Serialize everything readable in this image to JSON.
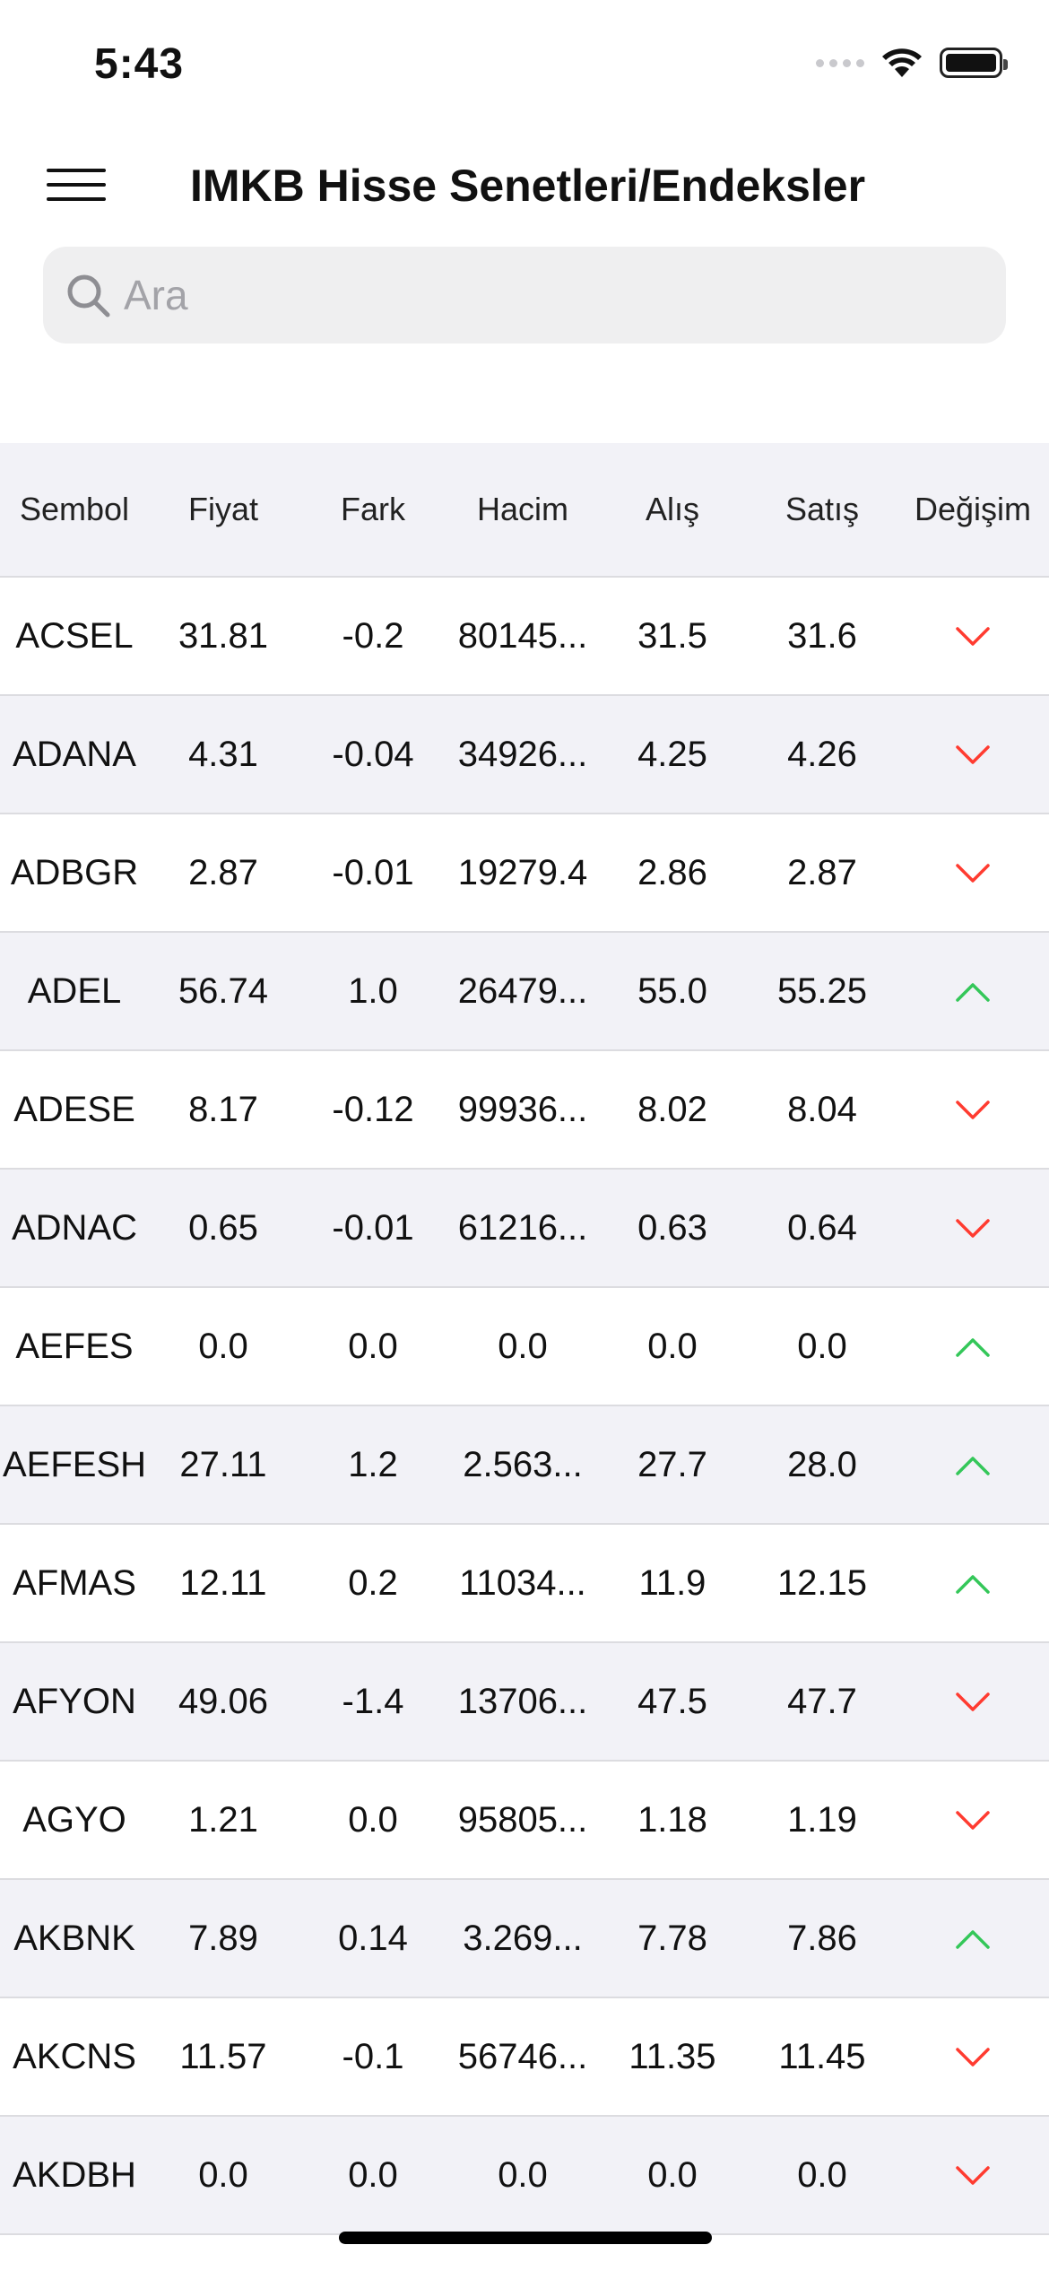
{
  "status": {
    "time": "5:43"
  },
  "nav": {
    "title": "IMKB Hisse Senetleri/Endeksler"
  },
  "search": {
    "placeholder": "Ara",
    "value": ""
  },
  "colors": {
    "down": "#ff3b30",
    "up": "#34c759"
  },
  "table": {
    "headers": [
      "Sembol",
      "Fiyat",
      "Fark",
      "Hacim",
      "Alış",
      "Satış",
      "Değişim"
    ],
    "rows": [
      {
        "sembol": "ACSEL",
        "fiyat": "31.81",
        "fark": "-0.2",
        "hacim": "80145...",
        "alis": "31.5",
        "satis": "31.6",
        "trend": "down"
      },
      {
        "sembol": "ADANA",
        "fiyat": "4.31",
        "fark": "-0.04",
        "hacim": "34926...",
        "alis": "4.25",
        "satis": "4.26",
        "trend": "down"
      },
      {
        "sembol": "ADBGR",
        "fiyat": "2.87",
        "fark": "-0.01",
        "hacim": "19279.4",
        "alis": "2.86",
        "satis": "2.87",
        "trend": "down"
      },
      {
        "sembol": "ADEL",
        "fiyat": "56.74",
        "fark": "1.0",
        "hacim": "26479...",
        "alis": "55.0",
        "satis": "55.25",
        "trend": "up"
      },
      {
        "sembol": "ADESE",
        "fiyat": "8.17",
        "fark": "-0.12",
        "hacim": "99936...",
        "alis": "8.02",
        "satis": "8.04",
        "trend": "down"
      },
      {
        "sembol": "ADNAC",
        "fiyat": "0.65",
        "fark": "-0.01",
        "hacim": "61216...",
        "alis": "0.63",
        "satis": "0.64",
        "trend": "down"
      },
      {
        "sembol": "AEFES",
        "fiyat": "0.0",
        "fark": "0.0",
        "hacim": "0.0",
        "alis": "0.0",
        "satis": "0.0",
        "trend": "up"
      },
      {
        "sembol": "AEFESH",
        "fiyat": "27.11",
        "fark": "1.2",
        "hacim": "2.563...",
        "alis": "27.7",
        "satis": "28.0",
        "trend": "up"
      },
      {
        "sembol": "AFMAS",
        "fiyat": "12.11",
        "fark": "0.2",
        "hacim": "11034...",
        "alis": "11.9",
        "satis": "12.15",
        "trend": "up"
      },
      {
        "sembol": "AFYON",
        "fiyat": "49.06",
        "fark": "-1.4",
        "hacim": "13706...",
        "alis": "47.5",
        "satis": "47.7",
        "trend": "down"
      },
      {
        "sembol": "AGYO",
        "fiyat": "1.21",
        "fark": "0.0",
        "hacim": "95805...",
        "alis": "1.18",
        "satis": "1.19",
        "trend": "down"
      },
      {
        "sembol": "AKBNK",
        "fiyat": "7.89",
        "fark": "0.14",
        "hacim": "3.269...",
        "alis": "7.78",
        "satis": "7.86",
        "trend": "up"
      },
      {
        "sembol": "AKCNS",
        "fiyat": "11.57",
        "fark": "-0.1",
        "hacim": "56746...",
        "alis": "11.35",
        "satis": "11.45",
        "trend": "down"
      },
      {
        "sembol": "AKDBH",
        "fiyat": "0.0",
        "fark": "0.0",
        "hacim": "0.0",
        "alis": "0.0",
        "satis": "0.0",
        "trend": "down"
      }
    ]
  }
}
